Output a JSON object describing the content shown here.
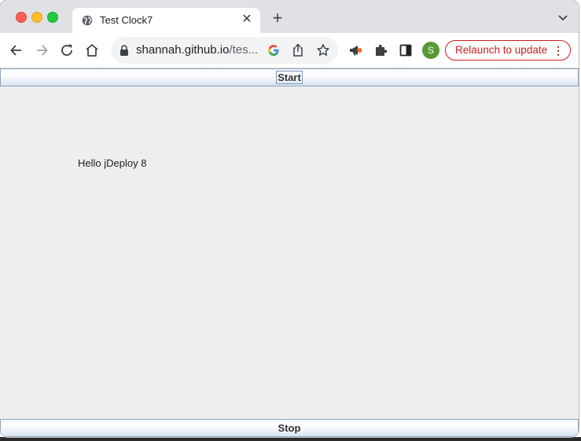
{
  "tab": {
    "title": "Test Clock7"
  },
  "address_bar": {
    "domain": "shannah.github.io",
    "path": "/tes..."
  },
  "profile": {
    "initial": "S"
  },
  "relaunch": {
    "label": "Relaunch to update"
  },
  "app": {
    "start_label": "Start",
    "message": "Hello jDeploy 8",
    "stop_label": "Stop"
  },
  "colors": {
    "relaunch_red": "#c5221f",
    "avatar_green": "#5a9a36",
    "page_bg": "#eeeeee"
  }
}
